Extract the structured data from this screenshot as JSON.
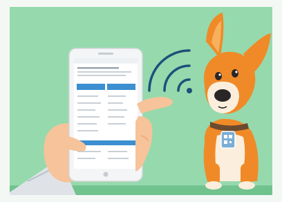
{
  "scene": {
    "subject": "hand-holding-phone-and-cartoon-dog",
    "colors": {
      "background": "#96d9ad",
      "background_edge": "#f4f8f5",
      "phone_body": "#f4f5f6",
      "phone_screen": "#ffffff",
      "phone_accent": "#3c8fd0",
      "signal_wave": "#1f4f7a",
      "skin": "#f6c39a",
      "skin_shadow": "#e9a97d",
      "sleeve": "#dfe3e8",
      "dog_orange": "#f08a28",
      "dog_cream": "#fbeedc",
      "dog_nose": "#2a2628",
      "collar": "#6b4a2f",
      "tag": "#7aaed6",
      "ground": "#2f9a57"
    },
    "icons": {
      "signal": "wifi-signal-icon",
      "tag": "qr-tag-icon"
    }
  }
}
